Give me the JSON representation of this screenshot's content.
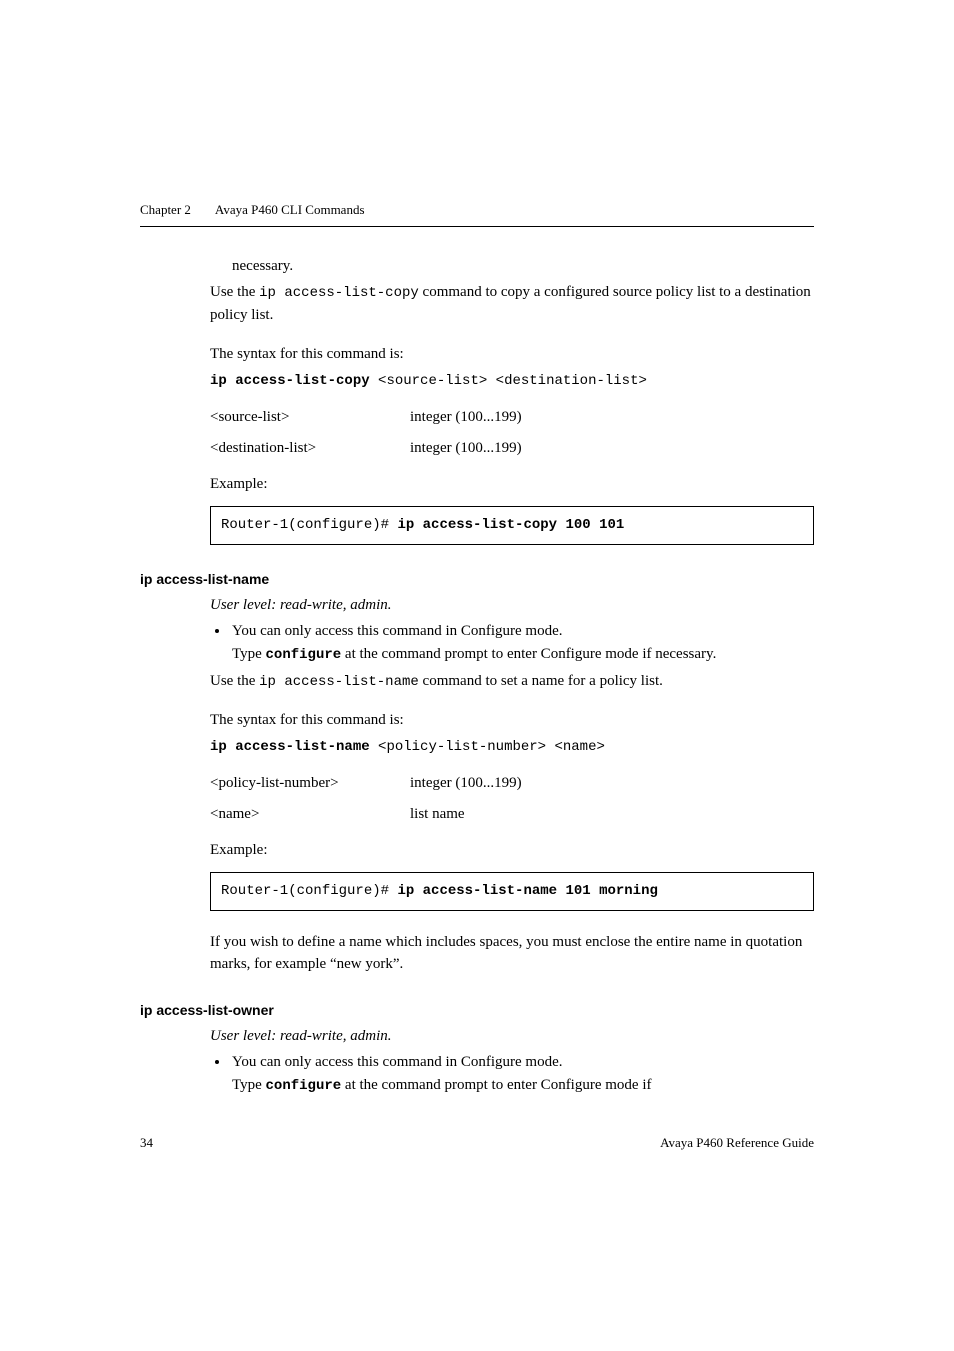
{
  "header": {
    "chapter": "Chapter 2",
    "title": "Avaya P460 CLI Commands"
  },
  "section1": {
    "cont_necessary": "necessary.",
    "use_prefix": "Use the ",
    "use_cmd": "ip access-list-copy",
    "use_suffix": " command to copy a configured source policy list to a destination policy list.",
    "syntax_intro": "The syntax for this command is:",
    "syntax_cmd": "ip access-list-copy",
    "syntax_args": " <source-list> <destination-list>",
    "params": [
      {
        "key": "<source-list>",
        "val": "integer (100...199)"
      },
      {
        "key": "<destination-list>",
        "val": "integer (100...199)"
      }
    ],
    "example_label": "Example:",
    "example_prompt": "Router-1(configure)# ",
    "example_cmd": "ip access-list-copy 100 101"
  },
  "section2": {
    "heading": "ip access-list-name",
    "user_level": "User level: read-write, admin.",
    "bullet_line1": "You can only access this command in Configure mode.",
    "bullet_line2a": "Type ",
    "bullet_line2_cmd": "configure",
    "bullet_line2b": " at the command prompt to enter Configure mode if necessary.",
    "use_prefix": "Use the ",
    "use_cmd": "ip access-list-name",
    "use_suffix": " command to set a name for a policy list.",
    "syntax_intro": "The syntax for this command is:",
    "syntax_cmd": "ip access-list-name",
    "syntax_args": " <policy-list-number> <name>",
    "params": [
      {
        "key": "<policy-list-number>",
        "val": "integer (100...199)"
      },
      {
        "key": "<name>",
        "val": "list name"
      }
    ],
    "example_label": "Example:",
    "example_prompt": "Router-1(configure)# ",
    "example_cmd": "ip access-list-name 101 morning",
    "note": "If you wish to define a name which includes spaces, you must enclose the entire name in quotation marks, for example “new york”."
  },
  "section3": {
    "heading": "ip access-list-owner",
    "user_level": "User level: read-write, admin.",
    "bullet_line1": "You can only access this command in Configure mode.",
    "bullet_line2a": "Type ",
    "bullet_line2_cmd": "configure",
    "bullet_line2b": " at the command prompt to enter Configure mode if"
  },
  "footer": {
    "page": "34",
    "label": "Avaya P460 Reference Guide"
  }
}
